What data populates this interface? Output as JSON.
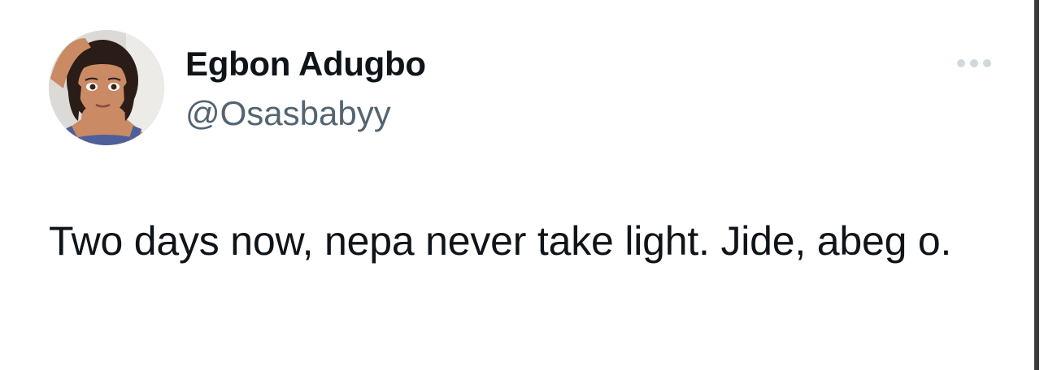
{
  "user": {
    "display_name": "Egbon Adugbo",
    "handle": "@Osasbabyy"
  },
  "tweet": {
    "text": "Two days now, nepa never take light. Jide, abeg o."
  },
  "icons": {
    "more": "more-dots-icon"
  },
  "colors": {
    "text_primary": "#0f1419",
    "text_secondary": "#536471",
    "icon_muted": "#cfd9de",
    "background": "#ffffff"
  }
}
